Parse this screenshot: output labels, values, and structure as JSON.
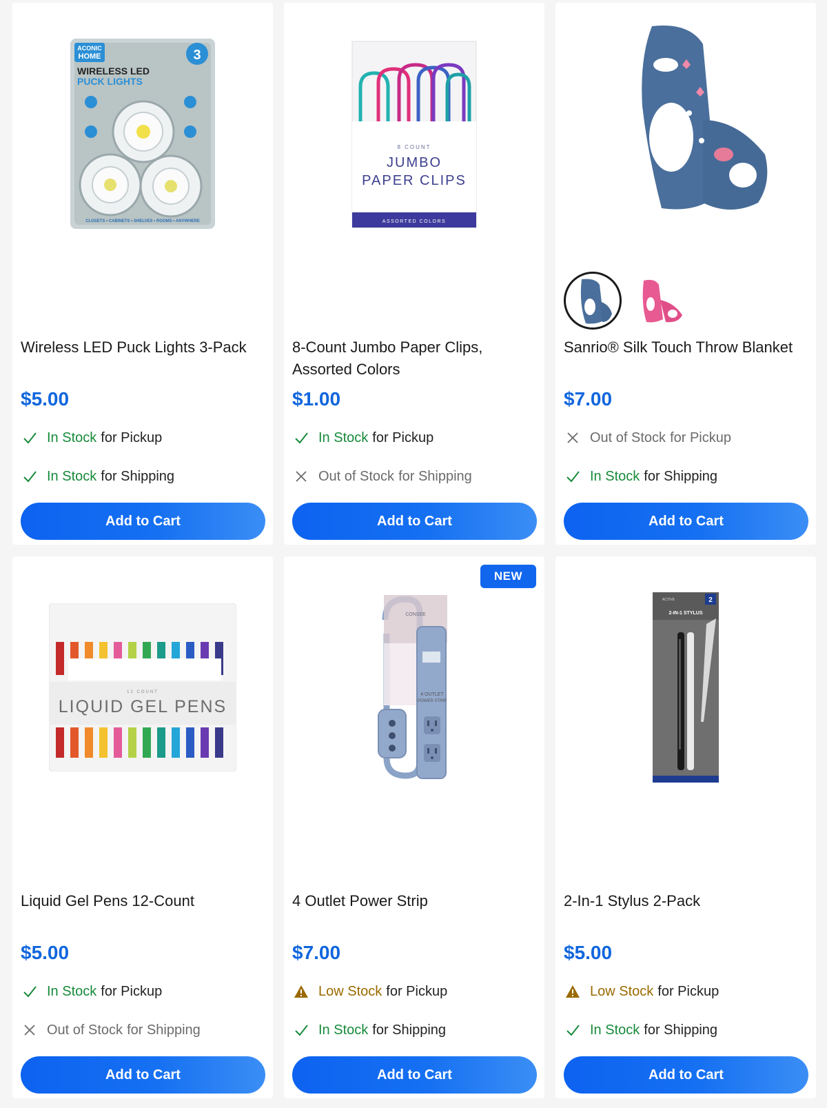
{
  "colors": {
    "accent": "#1166dd",
    "in_stock": "#178a3a",
    "out_of_stock": "#6b6b6b",
    "low_stock": "#9a6a00"
  },
  "products": [
    {
      "title": "Wireless LED Puck Lights 3-Pack",
      "price": "$5.00",
      "pickup": {
        "status": "In Stock",
        "suffix": "for Pickup",
        "icon": "check-icon"
      },
      "shipping": {
        "status": "In Stock",
        "suffix": "for Shipping",
        "icon": "check-icon"
      },
      "button": "Add to Cart",
      "image": {
        "brand_top": "ACONIC",
        "brand_bottom": "HOME",
        "pack_count": "3",
        "line1": "WIRELESS LED",
        "line2": "PUCK LIGHTS",
        "footer": "CLOSETS • CABINETS • SHELVES • ROOMS • ANYWHERE"
      }
    },
    {
      "title": "8-Count Jumbo Paper Clips, Assorted Colors",
      "price": "$1.00",
      "pickup": {
        "status": "In Stock",
        "suffix": "for Pickup",
        "icon": "check-icon"
      },
      "shipping": {
        "status": "Out of Stock",
        "suffix": "for Shipping",
        "icon": "x-icon"
      },
      "button": "Add to Cart",
      "image": {
        "count": "8 COUNT",
        "line1": "JUMBO",
        "line2": "PAPER CLIPS",
        "footer": "ASSORTED COLORS"
      }
    },
    {
      "title": "Sanrio® Silk Touch Throw Blanket",
      "price": "$7.00",
      "pickup": {
        "status": "Out of Stock",
        "suffix": "for Pickup",
        "icon": "x-icon"
      },
      "shipping": {
        "status": "In Stock",
        "suffix": "for Shipping",
        "icon": "check-icon"
      },
      "button": "Add to Cart",
      "swatches": [
        "blue",
        "pink"
      ]
    },
    {
      "title": "Liquid Gel Pens 12-Count",
      "price": "$5.00",
      "pickup": {
        "status": "In Stock",
        "suffix": "for Pickup",
        "icon": "check-icon"
      },
      "shipping": {
        "status": "Out of Stock",
        "suffix": "for Shipping",
        "icon": "x-icon"
      },
      "button": "Add to Cart",
      "image": {
        "count": "12 COUNT",
        "label": "LIQUID GEL PENS"
      }
    },
    {
      "title": "4 Outlet Power Strip",
      "price": "$7.00",
      "badge": "NEW",
      "pickup": {
        "status": "Low Stock",
        "suffix": "for Pickup",
        "icon": "warning-icon"
      },
      "shipping": {
        "status": "In Stock",
        "suffix": "for Shipping",
        "icon": "check-icon"
      },
      "button": "Add to Cart",
      "image": {
        "brand": "CONSEE",
        "label_line1": "4 OUTLET",
        "label_line2": "POWER STRIP"
      }
    },
    {
      "title": "2-In-1 Stylus 2-Pack",
      "price": "$5.00",
      "pickup": {
        "status": "Low Stock",
        "suffix": "for Pickup",
        "icon": "warning-icon"
      },
      "shipping": {
        "status": "In Stock",
        "suffix": "for Shipping",
        "icon": "check-icon"
      },
      "button": "Add to Cart",
      "image": {
        "brand": "ACTIVE",
        "pack_count": "2",
        "label": "2-IN-1 STYLUS"
      }
    }
  ]
}
